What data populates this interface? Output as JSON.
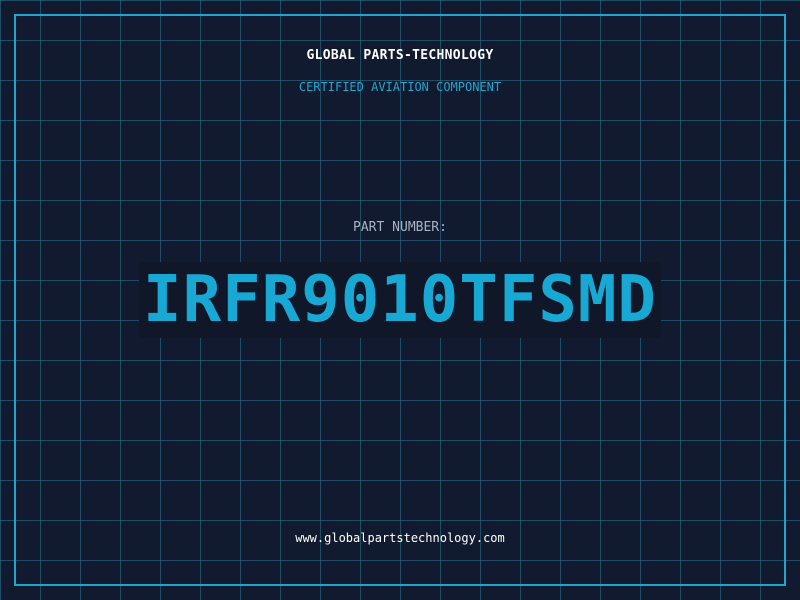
{
  "header": {
    "company": "GLOBAL PARTS-TECHNOLOGY",
    "tagline": "CERTIFIED AVIATION COMPONENT"
  },
  "part": {
    "label": "PART NUMBER:",
    "number": "IRFR9010TFSMD"
  },
  "footer": {
    "website": "www.globalpartstechnology.com"
  },
  "colors": {
    "background": "#111a2e",
    "accent": "#1fa6cf",
    "grid": "#28788f"
  }
}
